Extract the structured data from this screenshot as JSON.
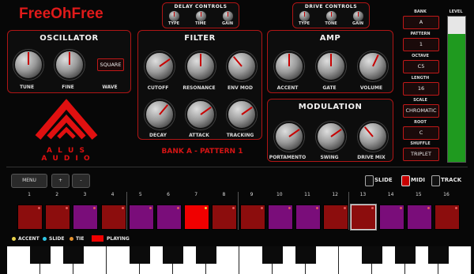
{
  "app": {
    "title": "FreeOhFree"
  },
  "delay": {
    "title": "DELAY CONTROLS",
    "knobs": [
      "TYPE",
      "TIME",
      "GAIN"
    ]
  },
  "drive": {
    "title": "DRIVE CONTROLS",
    "knobs": [
      "TYPE",
      "TONE",
      "GAIN"
    ]
  },
  "oscillator": {
    "title": "OSCILLATOR",
    "tune": "TUNE",
    "fine": "FINE",
    "wave": "WAVE",
    "wave_value": "SQUARE"
  },
  "filter": {
    "title": "FILTER",
    "knobs": [
      "CUTOFF",
      "RESONANCE",
      "ENV MOD",
      "DECAY",
      "ATTACK",
      "TRACKING"
    ]
  },
  "amp": {
    "title": "AMP",
    "knobs": [
      "ACCENT",
      "GATE",
      "VOLUME"
    ]
  },
  "modulation": {
    "title": "MODULATION",
    "knobs": [
      "PORTAMENTO",
      "SWING",
      "DRIVE MIX"
    ]
  },
  "logo": {
    "line1": "A L U S",
    "line2": "A U D I O"
  },
  "bank_pattern": "BANK A - PATTERN 1",
  "right": {
    "bank_label": "BANK",
    "bank_value": "A",
    "pattern_label": "PATTERN",
    "pattern_value": "1",
    "octave_label": "OCTAVE",
    "octave_value": "C5",
    "length_label": "LENGTH",
    "length_value": "16",
    "scale_label": "SCALE",
    "scale_value": "CHROMATIC",
    "root_label": "ROOT",
    "root_value": "C",
    "shuffle_label": "SHUFFLE",
    "shuffle_value": "TRIPLET"
  },
  "level": {
    "label": "LEVEL",
    "value": 0.88
  },
  "toolbar": {
    "menu": "MENU",
    "plus": "+",
    "minus": "-"
  },
  "modes": {
    "slide": "SLIDE",
    "midi": "MIDI",
    "track": "TRACK"
  },
  "steps": {
    "numbers": [
      "1",
      "2",
      "3",
      "4",
      "5",
      "6",
      "7",
      "8",
      "9",
      "10",
      "11",
      "12",
      "13",
      "14",
      "15",
      "16"
    ],
    "colors": [
      "#8c0d0d",
      "#8c0d0d",
      "#7a0d7a",
      "#8c0d0d",
      "#7a0d7a",
      "#7a0d7a",
      "#f00000",
      "#8c0d0d",
      "#8c0d0d",
      "#7a0d7a",
      "#7a0d7a",
      "#8c0d0d",
      "#8c0d0d",
      "#7a0d7a",
      "#7a0d7a",
      "#8c0d0d"
    ]
  },
  "legend": {
    "accent": "ACCENT",
    "slide": "SLIDE",
    "tie": "TIE",
    "playing": "PLAYING"
  },
  "colors": {
    "accent": "#d41414",
    "panel_border": "#b01515",
    "level_green": "#1f9a1f",
    "accent_dot": "#e8d24a",
    "slide_dot": "#2ec7e6",
    "tie_dot": "#e6922e"
  }
}
